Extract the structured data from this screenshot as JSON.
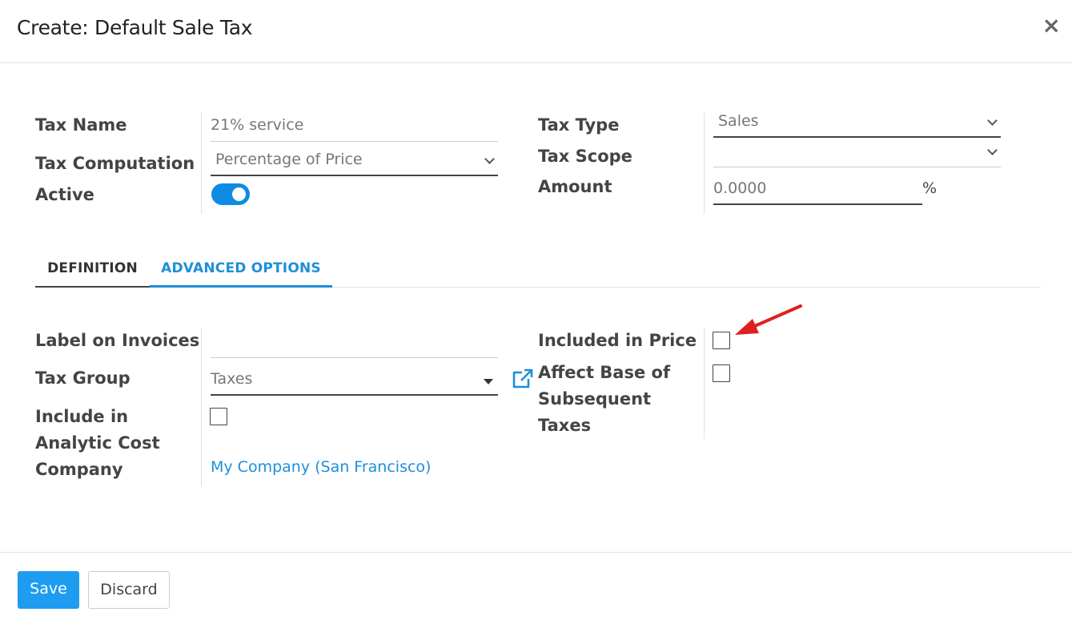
{
  "dialog": {
    "title": "Create: Default Sale Tax",
    "close_label": "×"
  },
  "form_left": {
    "tax_name_label": "Tax Name",
    "tax_name_value": "21% service",
    "tax_computation_label": "Tax Computation",
    "tax_computation_value": "Percentage of Price",
    "active_label": "Active",
    "active_on": true
  },
  "form_right": {
    "tax_type_label": "Tax Type",
    "tax_type_value": "Sales",
    "tax_scope_label": "Tax Scope",
    "tax_scope_value": "",
    "amount_label": "Amount",
    "amount_value": "0.0000",
    "amount_unit": "%"
  },
  "tabs": [
    {
      "label": "DEFINITION",
      "active": false
    },
    {
      "label": "ADVANCED OPTIONS",
      "active": true
    }
  ],
  "advanced": {
    "label_on_invoices_label": "Label on Invoices",
    "label_on_invoices_value": "",
    "tax_group_label": "Tax Group",
    "tax_group_value": "Taxes",
    "include_analytic_label_1": "Include in",
    "include_analytic_label_2": "Analytic Cost",
    "include_analytic_checked": false,
    "company_label": "Company",
    "company_value": "My Company (San Francisco)",
    "included_in_price_label": "Included in Price",
    "included_in_price_checked": false,
    "affect_base_label_1": "Affect Base of",
    "affect_base_label_2": "Subsequent",
    "affect_base_label_3": "Taxes",
    "affect_base_checked": false
  },
  "footer": {
    "save_label": "Save",
    "discard_label": "Discard"
  },
  "colors": {
    "accent": "#1e9cf0",
    "link": "#1e8fd9",
    "annotation_arrow": "#e02020"
  },
  "icons": [
    "close-icon",
    "chevron-down-icon",
    "caret-down-icon",
    "external-link-icon",
    "annotation-arrow-icon"
  ]
}
